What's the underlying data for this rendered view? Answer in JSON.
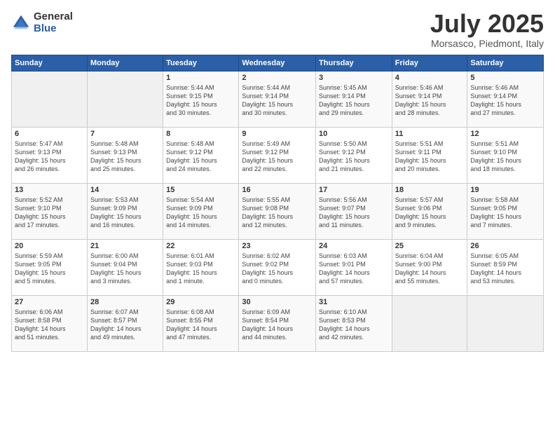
{
  "header": {
    "logo_general": "General",
    "logo_blue": "Blue",
    "month": "July 2025",
    "location": "Morsasco, Piedmont, Italy"
  },
  "weekdays": [
    "Sunday",
    "Monday",
    "Tuesday",
    "Wednesday",
    "Thursday",
    "Friday",
    "Saturday"
  ],
  "weeks": [
    [
      {
        "day": "",
        "info": ""
      },
      {
        "day": "",
        "info": ""
      },
      {
        "day": "1",
        "info": "Sunrise: 5:44 AM\nSunset: 9:15 PM\nDaylight: 15 hours\nand 30 minutes."
      },
      {
        "day": "2",
        "info": "Sunrise: 5:44 AM\nSunset: 9:14 PM\nDaylight: 15 hours\nand 30 minutes."
      },
      {
        "day": "3",
        "info": "Sunrise: 5:45 AM\nSunset: 9:14 PM\nDaylight: 15 hours\nand 29 minutes."
      },
      {
        "day": "4",
        "info": "Sunrise: 5:46 AM\nSunset: 9:14 PM\nDaylight: 15 hours\nand 28 minutes."
      },
      {
        "day": "5",
        "info": "Sunrise: 5:46 AM\nSunset: 9:14 PM\nDaylight: 15 hours\nand 27 minutes."
      }
    ],
    [
      {
        "day": "6",
        "info": "Sunrise: 5:47 AM\nSunset: 9:13 PM\nDaylight: 15 hours\nand 26 minutes."
      },
      {
        "day": "7",
        "info": "Sunrise: 5:48 AM\nSunset: 9:13 PM\nDaylight: 15 hours\nand 25 minutes."
      },
      {
        "day": "8",
        "info": "Sunrise: 5:48 AM\nSunset: 9:12 PM\nDaylight: 15 hours\nand 24 minutes."
      },
      {
        "day": "9",
        "info": "Sunrise: 5:49 AM\nSunset: 9:12 PM\nDaylight: 15 hours\nand 22 minutes."
      },
      {
        "day": "10",
        "info": "Sunrise: 5:50 AM\nSunset: 9:12 PM\nDaylight: 15 hours\nand 21 minutes."
      },
      {
        "day": "11",
        "info": "Sunrise: 5:51 AM\nSunset: 9:11 PM\nDaylight: 15 hours\nand 20 minutes."
      },
      {
        "day": "12",
        "info": "Sunrise: 5:51 AM\nSunset: 9:10 PM\nDaylight: 15 hours\nand 18 minutes."
      }
    ],
    [
      {
        "day": "13",
        "info": "Sunrise: 5:52 AM\nSunset: 9:10 PM\nDaylight: 15 hours\nand 17 minutes."
      },
      {
        "day": "14",
        "info": "Sunrise: 5:53 AM\nSunset: 9:09 PM\nDaylight: 15 hours\nand 16 minutes."
      },
      {
        "day": "15",
        "info": "Sunrise: 5:54 AM\nSunset: 9:09 PM\nDaylight: 15 hours\nand 14 minutes."
      },
      {
        "day": "16",
        "info": "Sunrise: 5:55 AM\nSunset: 9:08 PM\nDaylight: 15 hours\nand 12 minutes."
      },
      {
        "day": "17",
        "info": "Sunrise: 5:56 AM\nSunset: 9:07 PM\nDaylight: 15 hours\nand 11 minutes."
      },
      {
        "day": "18",
        "info": "Sunrise: 5:57 AM\nSunset: 9:06 PM\nDaylight: 15 hours\nand 9 minutes."
      },
      {
        "day": "19",
        "info": "Sunrise: 5:58 AM\nSunset: 9:05 PM\nDaylight: 15 hours\nand 7 minutes."
      }
    ],
    [
      {
        "day": "20",
        "info": "Sunrise: 5:59 AM\nSunset: 9:05 PM\nDaylight: 15 hours\nand 5 minutes."
      },
      {
        "day": "21",
        "info": "Sunrise: 6:00 AM\nSunset: 9:04 PM\nDaylight: 15 hours\nand 3 minutes."
      },
      {
        "day": "22",
        "info": "Sunrise: 6:01 AM\nSunset: 9:03 PM\nDaylight: 15 hours\nand 1 minute."
      },
      {
        "day": "23",
        "info": "Sunrise: 6:02 AM\nSunset: 9:02 PM\nDaylight: 15 hours\nand 0 minutes."
      },
      {
        "day": "24",
        "info": "Sunrise: 6:03 AM\nSunset: 9:01 PM\nDaylight: 14 hours\nand 57 minutes."
      },
      {
        "day": "25",
        "info": "Sunrise: 6:04 AM\nSunset: 9:00 PM\nDaylight: 14 hours\nand 55 minutes."
      },
      {
        "day": "26",
        "info": "Sunrise: 6:05 AM\nSunset: 8:59 PM\nDaylight: 14 hours\nand 53 minutes."
      }
    ],
    [
      {
        "day": "27",
        "info": "Sunrise: 6:06 AM\nSunset: 8:58 PM\nDaylight: 14 hours\nand 51 minutes."
      },
      {
        "day": "28",
        "info": "Sunrise: 6:07 AM\nSunset: 8:57 PM\nDaylight: 14 hours\nand 49 minutes."
      },
      {
        "day": "29",
        "info": "Sunrise: 6:08 AM\nSunset: 8:55 PM\nDaylight: 14 hours\nand 47 minutes."
      },
      {
        "day": "30",
        "info": "Sunrise: 6:09 AM\nSunset: 8:54 PM\nDaylight: 14 hours\nand 44 minutes."
      },
      {
        "day": "31",
        "info": "Sunrise: 6:10 AM\nSunset: 8:53 PM\nDaylight: 14 hours\nand 42 minutes."
      },
      {
        "day": "",
        "info": ""
      },
      {
        "day": "",
        "info": ""
      }
    ]
  ]
}
